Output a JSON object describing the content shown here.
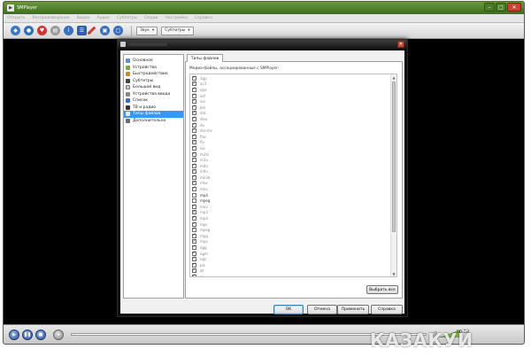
{
  "window": {
    "title": "SMPlayer"
  },
  "menu": {
    "items": [
      "Открыть",
      "Воспроизведение",
      "Видео",
      "Аудио",
      "Субтитры",
      "Опции",
      "Настройки",
      "Справка"
    ]
  },
  "toolbar": {
    "audio_combo": "Звук",
    "subtitles_combo": "Субтитры"
  },
  "dialog": {
    "sidebar_items": [
      "Основное",
      "Устройства",
      "Быстродействие",
      "Субтитры",
      "Большой вид",
      "Устройства ввода",
      "Список",
      "ТВ и радио",
      "Типы файлов",
      "Дополнительно"
    ],
    "selected_index": 8,
    "tab_label": "Типы файлов",
    "description": "Медиа-файлы, ассоциированные с SMPlayer:",
    "extensions": [
      {
        "name": "3gp",
        "checked": true
      },
      {
        "name": "ac3",
        "checked": true
      },
      {
        "name": "ape",
        "checked": true
      },
      {
        "name": "asf",
        "checked": true
      },
      {
        "name": "avi",
        "checked": true
      },
      {
        "name": "bin",
        "checked": true
      },
      {
        "name": "dat",
        "checked": true
      },
      {
        "name": "divx",
        "checked": true
      },
      {
        "name": "dv",
        "checked": true
      },
      {
        "name": "dvr-ms",
        "checked": true
      },
      {
        "name": "flac",
        "checked": true
      },
      {
        "name": "flv",
        "checked": true
      },
      {
        "name": "iso",
        "checked": true
      },
      {
        "name": "m2ts",
        "checked": true
      },
      {
        "name": "m3u",
        "checked": true
      },
      {
        "name": "m4a",
        "checked": true
      },
      {
        "name": "m4v",
        "checked": true
      },
      {
        "name": "mk3d",
        "checked": true
      },
      {
        "name": "mka",
        "checked": true
      },
      {
        "name": "mkv",
        "checked": true
      },
      {
        "name": "mp4",
        "checked": false
      },
      {
        "name": "mpeg",
        "checked": false
      },
      {
        "name": "mov",
        "checked": true
      },
      {
        "name": "mp3",
        "checked": true
      },
      {
        "name": "mp4",
        "checked": true
      },
      {
        "name": "mpc",
        "checked": true
      },
      {
        "name": "mpeg",
        "checked": true
      },
      {
        "name": "mpg",
        "checked": true
      },
      {
        "name": "mpv",
        "checked": true
      },
      {
        "name": "ogg",
        "checked": true
      },
      {
        "name": "ogm",
        "checked": true
      },
      {
        "name": "ogv",
        "checked": true
      },
      {
        "name": "pls",
        "checked": true
      },
      {
        "name": "qt",
        "checked": true
      },
      {
        "name": "ra",
        "checked": true
      },
      {
        "name": "ram",
        "checked": true
      },
      {
        "name": "rm",
        "checked": true
      }
    ],
    "select_all_label": "Выбрать все",
    "ok_label": "OK",
    "cancel_label": "Отмена",
    "apply_label": "Применить",
    "help_label": "Справка"
  },
  "controls": {
    "time": "00:00"
  },
  "watermark": "КАЗАКУЙ"
}
